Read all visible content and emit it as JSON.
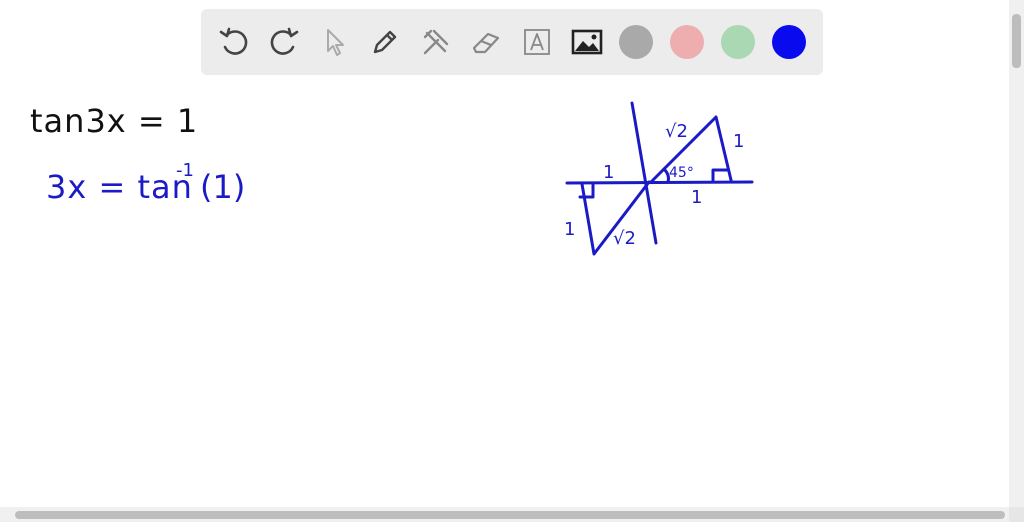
{
  "toolbar": {
    "tools": [
      "undo-icon",
      "redo-icon",
      "pointer-icon",
      "pen-icon",
      "tools-icon",
      "eraser-icon",
      "text-icon",
      "image-icon"
    ],
    "colors": [
      "#a9a9a9",
      "#eeaeb0",
      "#a9d8b2",
      "#0a0aee"
    ]
  },
  "board": {
    "line1": "tan3x = 1",
    "line2_lhs": "3x = tan",
    "line2_sup": "-1",
    "line2_rhs": "(1)",
    "ink_black": "#111111",
    "ink_blue": "#1b1bc6"
  },
  "diagram": {
    "labels": {
      "hyp_top": "√2",
      "side_right": "1",
      "base_left": "1",
      "angle": "45°",
      "base_right": "1",
      "side_left": "1",
      "hyp_bottom": "√2"
    }
  }
}
